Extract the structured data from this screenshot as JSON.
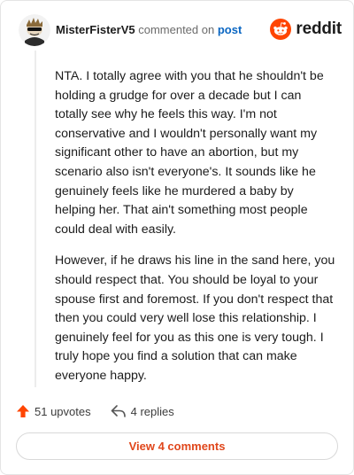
{
  "header": {
    "username": "MisterFisterV5",
    "verb": "commented on",
    "post_link": "post",
    "brand": "reddit"
  },
  "comment": {
    "paragraphs": [
      "NTA. I totally agree with you that he shouldn't be holding a grudge for over a decade but I can totally see why he feels this way. I'm not conservative and I wouldn't personally want my significant other to have an abortion, but my scenario also isn't everyone's. It sounds like he genuinely feels like he murdered a baby by helping her. That ain't something most people could deal with easily.",
      "However, if he draws his line in the sand here, you should respect that. You should be loyal to your spouse first and foremost. If you don't respect that then you could very well lose this relationship. I genuinely feel for you as this one is very tough. I truly hope you find a solution that can make everyone happy."
    ]
  },
  "actions": {
    "upvotes": "51 upvotes",
    "replies": "4 replies"
  },
  "view_button": "View 4 comments",
  "icons": {
    "upvote": "upvote-arrow-icon",
    "reply": "reply-arrow-icon",
    "brand": "reddit-logo-icon",
    "avatar": "user-avatar"
  },
  "colors": {
    "upvote": "#ff4500",
    "link": "#0a66c2",
    "view_button_text": "#e0471c",
    "brand": "#ff4500"
  }
}
